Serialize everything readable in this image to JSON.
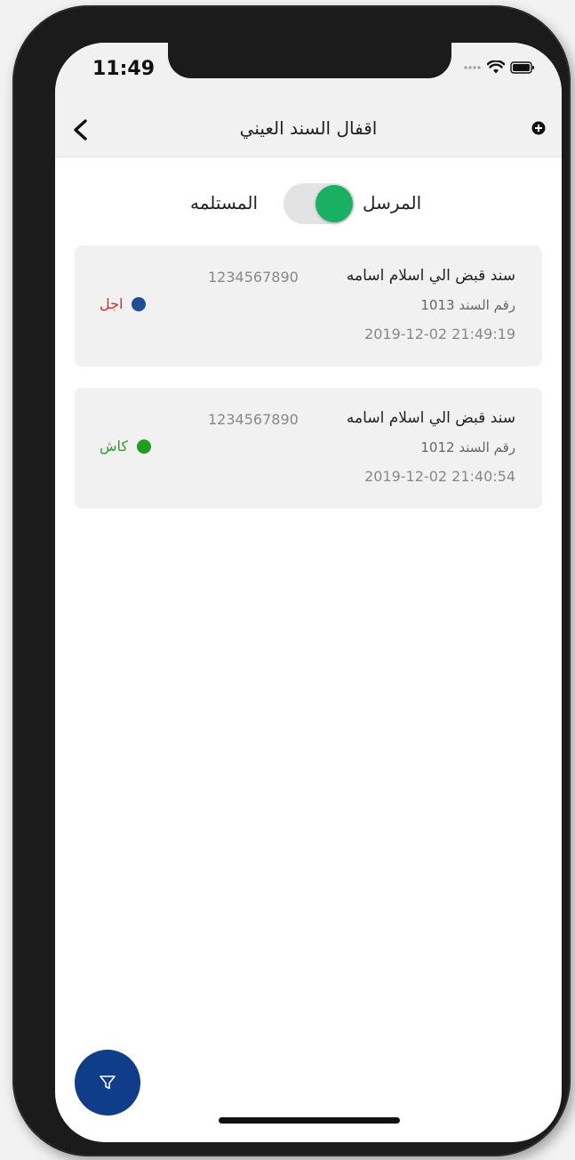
{
  "status_bar": {
    "time": "11:49",
    "signal_icon": "signal-dots-icon",
    "wifi_icon": "wifi-icon",
    "battery_icon": "battery-icon"
  },
  "nav": {
    "title": "اقفال السند العيني",
    "back_icon": "chevron-left-icon",
    "add_icon": "add-icon"
  },
  "toggle": {
    "left_label": "المستلمه",
    "right_label": "المرسل",
    "state": "on",
    "active_color": "#19b061"
  },
  "vouchers": [
    {
      "title": "سند قبض الي اسلام اسامه",
      "phone": "1234567890",
      "number_label": "رقم السند 1013",
      "date": "2019-12-02 21:49:19",
      "status_label": "اجل",
      "status_color": "#c0392b",
      "dot_color": "#1f4e96"
    },
    {
      "title": "سند قبض الي اسلام اسامه",
      "phone": "1234567890",
      "number_label": "رقم السند 1012",
      "date": "2019-12-02 21:40:54",
      "status_label": "كاش",
      "status_color": "#2aa02a",
      "dot_color": "#1f9e1f"
    }
  ],
  "fab": {
    "icon": "filter-icon",
    "color": "#0f3d8a"
  }
}
